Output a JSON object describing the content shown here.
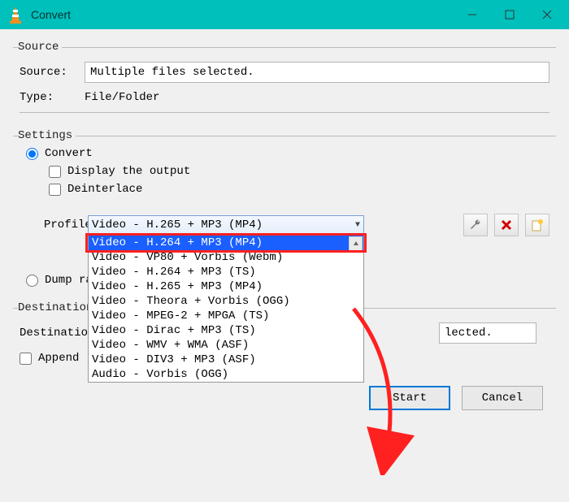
{
  "window": {
    "title": "Convert"
  },
  "source": {
    "legend": "Source",
    "source_label": "Source:",
    "source_value": "Multiple files selected.",
    "type_label": "Type:",
    "type_value": "File/Folder"
  },
  "settings": {
    "legend": "Settings",
    "convert_label": "Convert",
    "display_output_label": "Display the output",
    "deinterlace_label": "Deinterlace",
    "profile_label": "Profile",
    "profile_selected": "Video - H.265 + MP3 (MP4)",
    "profile_options": [
      "Video - H.264 + MP3 (MP4)",
      "Video - VP80 + Vorbis (Webm)",
      "Video - H.264 + MP3 (TS)",
      "Video - H.265 + MP3 (MP4)",
      "Video - Theora + Vorbis (OGG)",
      "Video - MPEG-2 + MPGA (TS)",
      "Video - Dirac + MP3 (TS)",
      "Video - WMV + WMA (ASF)",
      "Video - DIV3 + MP3 (ASF)",
      "Audio - Vorbis (OGG)"
    ],
    "dump_label": "Dump raw input"
  },
  "destination": {
    "legend": "Destination",
    "file_label": "Destination file:",
    "file_value_visible": "lected.",
    "append_label": "Append '-conve"
  },
  "buttons": {
    "start": "Start",
    "cancel": "Cancel"
  },
  "icons": {
    "wrench": "wrench-icon",
    "delete": "delete-icon",
    "new": "new-profile-icon"
  }
}
